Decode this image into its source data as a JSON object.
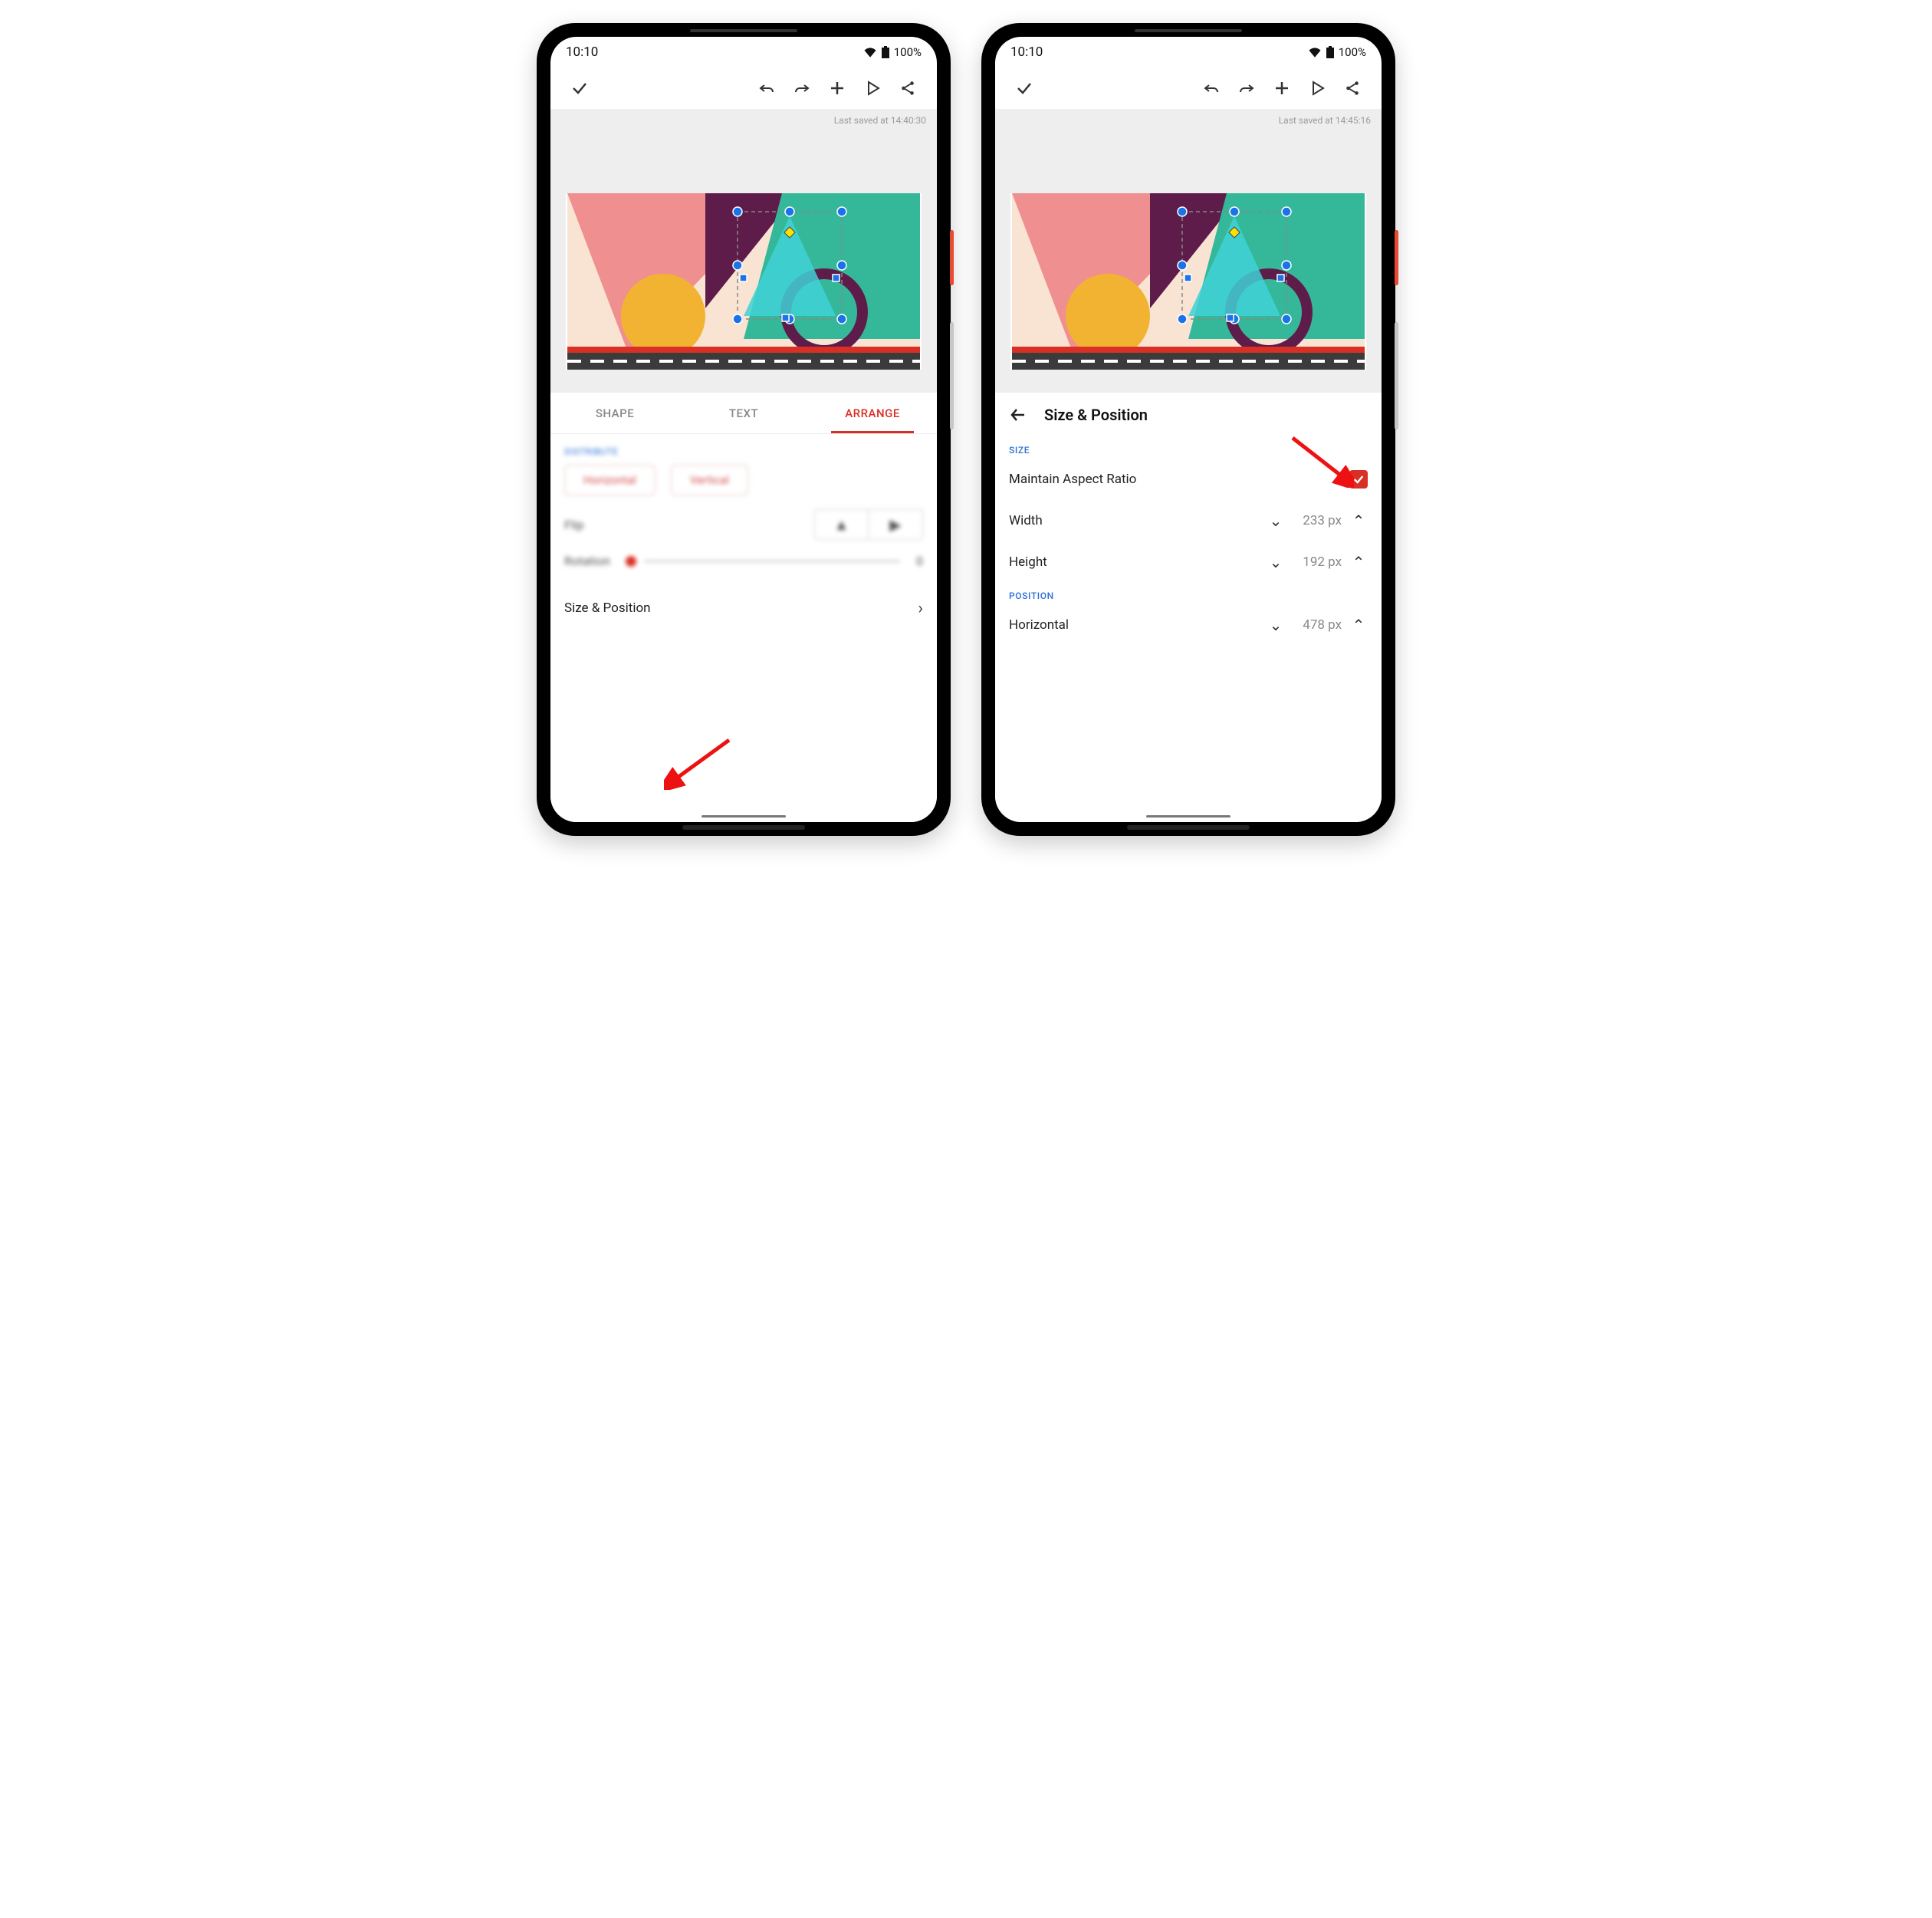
{
  "statusbar": {
    "time": "10:10",
    "battery": "100%"
  },
  "toolbar_icons": [
    "check",
    "undo",
    "redo",
    "plus",
    "play",
    "share"
  ],
  "left": {
    "last_saved": "Last saved at 14:40:30",
    "tabs": {
      "shape": "SHAPE",
      "text": "TEXT",
      "arrange": "ARRANGE"
    },
    "distribute": {
      "label": "DISTRIBUTE",
      "horizontal": "Horizontal",
      "vertical": "Vertical"
    },
    "flip_label": "Flip",
    "rotation": {
      "label": "Rotation",
      "value": "0"
    },
    "size_position_label": "Size & Position"
  },
  "right": {
    "last_saved": "Last saved at 14:45:16",
    "panel_title": "Size & Position",
    "size_section": "SIZE",
    "maintain_ar": "Maintain Aspect Ratio",
    "width_label": "Width",
    "width_value": "233 px",
    "height_label": "Height",
    "height_value": "192 px",
    "position_section": "POSITION",
    "horizontal_label": "Horizontal",
    "horizontal_value": "478 px"
  }
}
